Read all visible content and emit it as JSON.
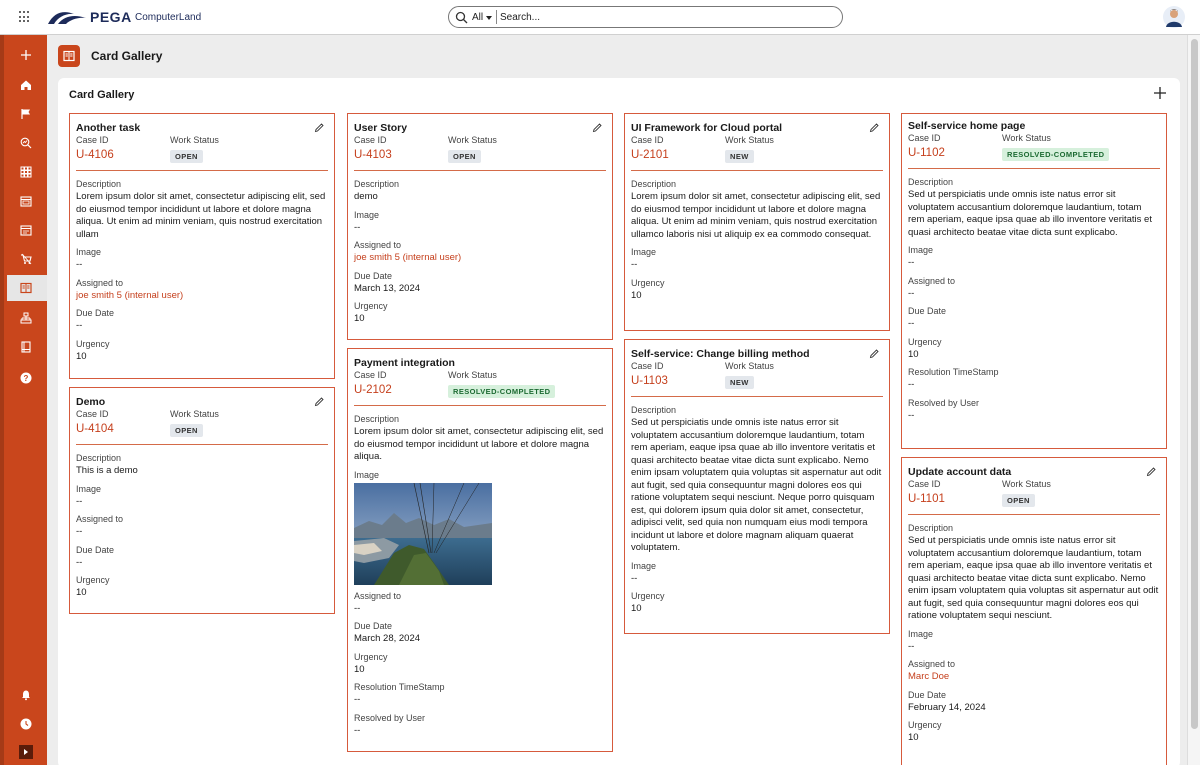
{
  "header": {
    "brand": "PEGA",
    "app_name": "ComputerLand",
    "search_scope": "All",
    "search_placeholder": "Search..."
  },
  "page": {
    "title": "Card Gallery",
    "panel_title": "Card Gallery"
  },
  "rail_icons": [
    "plus-icon",
    "home-icon",
    "flag-icon",
    "search-chart-icon",
    "grid-icon",
    "calendar-icon",
    "calendar-alt-icon",
    "shopping-cart-icon",
    "card-gallery-icon",
    "hierarchy-icon",
    "book-icon",
    "help-icon",
    "bell-icon",
    "clock-icon",
    "expand-icon"
  ],
  "labels": {
    "case_id": "Case ID",
    "work_status": "Work Status",
    "description": "Description",
    "image": "Image",
    "assigned_to": "Assigned to",
    "due_date": "Due Date",
    "urgency": "Urgency",
    "resolution_timestamp": "Resolution TimeStamp",
    "resolved_by": "Resolved by User"
  },
  "cards": [
    {
      "title": "Another task",
      "case_id": "U-4106",
      "status": "OPEN",
      "description": "Lorem ipsum dolor sit amet, consectetur adipiscing elit, sed do eiusmod tempor incididunt ut labore et dolore magna aliqua. Ut enim ad minim veniam, quis nostrud exercitation ullam",
      "image": "--",
      "assigned_to": "joe smith 5 (internal user)",
      "due_date": "--",
      "urgency": "10"
    },
    {
      "title": "Demo",
      "case_id": "U-4104",
      "status": "OPEN",
      "description": "This is a demo",
      "image": "--",
      "assigned_to": "--",
      "due_date": "--",
      "urgency": "10"
    },
    {
      "title": "User Story",
      "case_id": "U-4103",
      "status": "OPEN",
      "description": "demo",
      "image": "--",
      "assigned_to": "joe smith 5 (internal user)",
      "due_date": "March 13, 2024",
      "urgency": "10"
    },
    {
      "title": "Payment integration",
      "case_id": "U-2102",
      "status": "RESOLVED-COMPLETED",
      "description": "Lorem ipsum dolor sit amet, consectetur adipiscing elit, sed do eiusmod tempor incididunt ut labore et dolore magna aliqua.",
      "assigned_to": "--",
      "due_date": "March 28, 2024",
      "urgency": "10",
      "resolution_timestamp": "--",
      "resolved_by": "--"
    },
    {
      "title": "UI Framework for Cloud portal",
      "case_id": "U-2101",
      "status": "NEW",
      "description": "Lorem ipsum dolor sit amet, consectetur adipiscing elit, sed do eiusmod tempor incididunt ut labore et dolore magna aliqua. Ut enim ad minim veniam, quis nostrud exercitation ullamco laboris nisi ut aliquip ex ea commodo consequat.",
      "image": "--",
      "urgency": "10"
    },
    {
      "title": "Self-service: Change billing method",
      "case_id": "U-1103",
      "status": "NEW",
      "description": "Sed ut perspiciatis unde omnis iste natus error sit voluptatem accusantium doloremque laudantium, totam rem aperiam, eaque ipsa quae ab illo inventore veritatis et quasi architecto beatae vitae dicta sunt explicabo. Nemo enim ipsam voluptatem quia voluptas sit aspernatur aut odit aut fugit, sed quia consequuntur magni dolores eos qui ratione voluptatem sequi nesciunt. Neque porro quisquam est, qui dolorem ipsum quia dolor sit amet, consectetur, adipisci velit, sed quia non numquam eius modi tempora incidunt ut labore et dolore magnam aliquam quaerat voluptatem.",
      "image": "--",
      "urgency": "10"
    },
    {
      "title": "Self-service home page",
      "case_id": "U-1102",
      "status": "RESOLVED-COMPLETED",
      "description": "Sed ut perspiciatis unde omnis iste natus error sit voluptatem accusantium doloremque laudantium, totam rem aperiam, eaque ipsa quae ab illo inventore veritatis et quasi architecto beatae vitae dicta sunt explicabo.",
      "image": "--",
      "assigned_to": "--",
      "due_date": "--",
      "urgency": "10",
      "resolution_timestamp": "--",
      "resolved_by": "--"
    },
    {
      "title": "Update account data",
      "case_id": "U-1101",
      "status": "OPEN",
      "description": "Sed ut perspiciatis unde omnis iste natus error sit voluptatem accusantium doloremque laudantium, totam rem aperiam, eaque ipsa quae ab illo inventore veritatis et quasi architecto beatae vitae dicta sunt explicabo. Nemo enim ipsam voluptatem quia voluptas sit aspernatur aut odit aut fugit, sed quia consequuntur magni dolores eos qui ratione voluptatem sequi nesciunt.",
      "image": "--",
      "assigned_to": "Marc Doe",
      "due_date": "February 14, 2024",
      "urgency": "10"
    }
  ],
  "colors": {
    "accent": "#c9461c",
    "case_id": "#c53f1c",
    "resolved_badge": "#d6f0dc",
    "open_badge": "#e3e7ec"
  }
}
